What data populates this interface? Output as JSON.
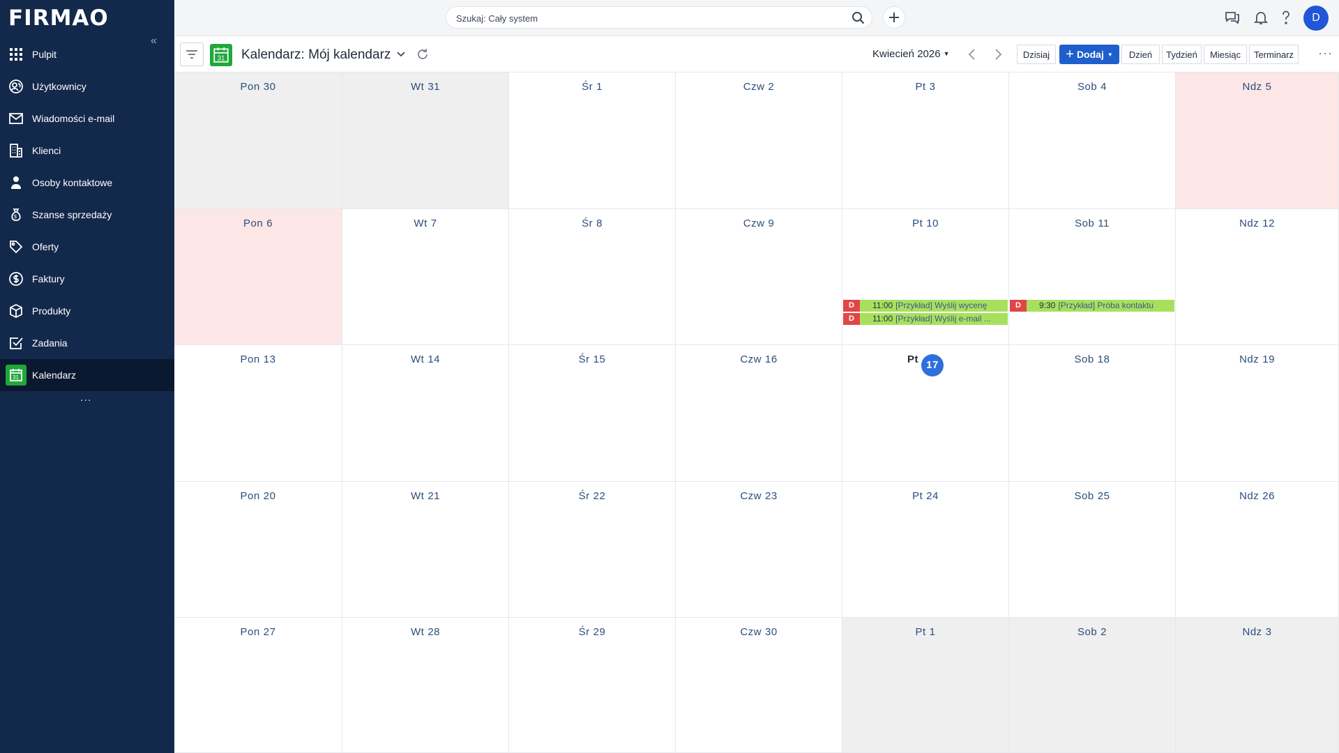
{
  "app": {
    "logo": "FIRMAO"
  },
  "sidebar": {
    "collapse_icon": "double-chevron-left-icon",
    "items": [
      {
        "label": "Pulpit",
        "icon": "grid-icon"
      },
      {
        "label": "Użytkownicy",
        "icon": "users-icon"
      },
      {
        "label": "Wiadomości e-mail",
        "icon": "mail-icon"
      },
      {
        "label": "Klienci",
        "icon": "building-icon"
      },
      {
        "label": "Osoby kontaktowe",
        "icon": "contacts-icon"
      },
      {
        "label": "Szanse sprzedaży",
        "icon": "money-bag-icon"
      },
      {
        "label": "Oferty",
        "icon": "tag-icon"
      },
      {
        "label": "Faktury",
        "icon": "dollar-icon"
      },
      {
        "label": "Produkty",
        "icon": "box-icon"
      },
      {
        "label": "Zadania",
        "icon": "checkbox-icon"
      },
      {
        "label": "Kalendarz",
        "icon": "calendar-icon",
        "active": true
      }
    ],
    "more": "..."
  },
  "topbar": {
    "search_placeholder": "Szukaj: Cały system",
    "avatar_letter": "D"
  },
  "toolbar": {
    "title": "Kalendarz: Mój kalendarz",
    "calendar_icon_day": "31",
    "month": "Kwiecień 2026",
    "today": "Dzisiaj",
    "add": "Dodaj",
    "views": [
      "Dzień",
      "Tydzień",
      "Miesiąc",
      "Terminarz"
    ],
    "more": "···"
  },
  "colors": {
    "sidebar": "#13294b",
    "accent": "#1f5fcc",
    "calendar_green": "#1fa83a",
    "event_bg": "#a8e05e",
    "event_tag": "#e04646",
    "holiday": "#fde6e6",
    "other_month": "#efefef"
  },
  "calendar": {
    "weeks": [
      [
        {
          "dow": "Pon",
          "num": "30",
          "state": "other"
        },
        {
          "dow": "Wt",
          "num": "31",
          "state": "other"
        },
        {
          "dow": "Śr",
          "num": "1"
        },
        {
          "dow": "Czw",
          "num": "2"
        },
        {
          "dow": "Pt",
          "num": "3"
        },
        {
          "dow": "Sob",
          "num": "4"
        },
        {
          "dow": "Ndz",
          "num": "5",
          "state": "holiday"
        }
      ],
      [
        {
          "dow": "Pon",
          "num": "6",
          "state": "holiday"
        },
        {
          "dow": "Wt",
          "num": "7"
        },
        {
          "dow": "Śr",
          "num": "8"
        },
        {
          "dow": "Czw",
          "num": "9"
        },
        {
          "dow": "Pt",
          "num": "10"
        },
        {
          "dow": "Sob",
          "num": "11"
        },
        {
          "dow": "Ndz",
          "num": "12"
        }
      ],
      [
        {
          "dow": "Pon",
          "num": "13"
        },
        {
          "dow": "Wt",
          "num": "14"
        },
        {
          "dow": "Śr",
          "num": "15"
        },
        {
          "dow": "Czw",
          "num": "16"
        },
        {
          "dow": "Pt",
          "num": "17",
          "today": true,
          "events": [
            {
              "tag": "D",
              "time": "11:00",
              "title": "[Przykład] Wyślij wycenę"
            },
            {
              "tag": "D",
              "time": "11:00",
              "title": "[Przykład] Wyślij e-mail ..."
            }
          ]
        },
        {
          "dow": "Sob",
          "num": "18",
          "events": [
            {
              "tag": "D",
              "time": "9:30",
              "title": "[Przykład] Próba kontaktu"
            }
          ]
        },
        {
          "dow": "Ndz",
          "num": "19"
        }
      ],
      [
        {
          "dow": "Pon",
          "num": "20"
        },
        {
          "dow": "Wt",
          "num": "21"
        },
        {
          "dow": "Śr",
          "num": "22"
        },
        {
          "dow": "Czw",
          "num": "23"
        },
        {
          "dow": "Pt",
          "num": "24"
        },
        {
          "dow": "Sob",
          "num": "25"
        },
        {
          "dow": "Ndz",
          "num": "26"
        }
      ],
      [
        {
          "dow": "Pon",
          "num": "27"
        },
        {
          "dow": "Wt",
          "num": "28"
        },
        {
          "dow": "Śr",
          "num": "29"
        },
        {
          "dow": "Czw",
          "num": "30"
        },
        {
          "dow": "Pt",
          "num": "1",
          "state": "other"
        },
        {
          "dow": "Sob",
          "num": "2",
          "state": "other"
        },
        {
          "dow": "Ndz",
          "num": "3",
          "state": "other"
        }
      ]
    ]
  }
}
